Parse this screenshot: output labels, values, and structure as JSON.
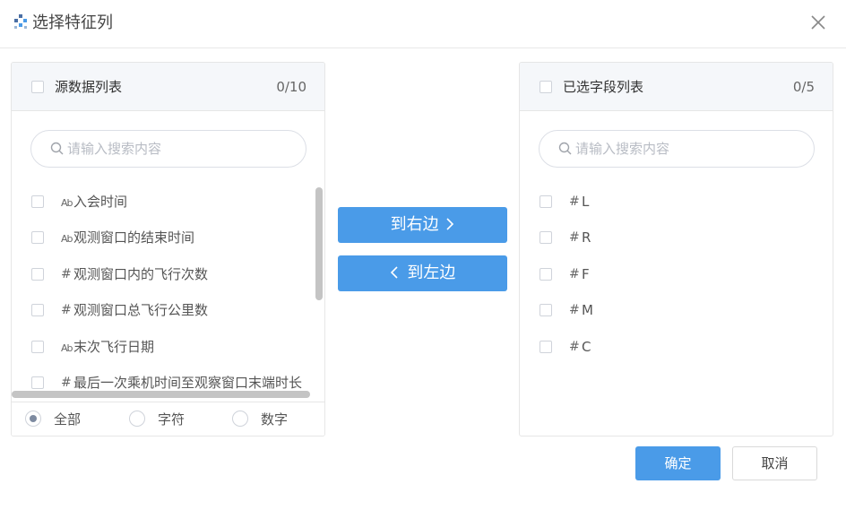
{
  "dialog": {
    "title": "选择特征列"
  },
  "source": {
    "title": "源数据列表",
    "count": "0/10",
    "search_placeholder": "请输入搜索内容",
    "items": [
      {
        "type": "Ab",
        "label": "入会时间"
      },
      {
        "type": "Ab",
        "label": "观测窗口的结束时间"
      },
      {
        "type": "#",
        "label": "观测窗口内的飞行次数"
      },
      {
        "type": "#",
        "label": "观测窗口总飞行公里数"
      },
      {
        "type": "Ab",
        "label": "末次飞行日期"
      },
      {
        "type": "#",
        "label": "最后一次乘机时间至观察窗口末端时长"
      }
    ],
    "filters": [
      {
        "label": "全部",
        "checked": true
      },
      {
        "label": "字符",
        "checked": false
      },
      {
        "label": "数字",
        "checked": false
      }
    ]
  },
  "transfer": {
    "to_right": "到右边",
    "to_left": "到左边"
  },
  "target": {
    "title": "已选字段列表",
    "count": "0/5",
    "search_placeholder": "请输入搜索内容",
    "items": [
      {
        "type": "#",
        "label": "L"
      },
      {
        "type": "#",
        "label": "R"
      },
      {
        "type": "#",
        "label": "F"
      },
      {
        "type": "#",
        "label": "M"
      },
      {
        "type": "#",
        "label": "C"
      }
    ]
  },
  "footer": {
    "ok_label": "确定",
    "cancel_label": "取消"
  },
  "colors": {
    "primary": "#4a9be8",
    "panel_header_bg": "#f5f7fa",
    "scrollbar": "#c4c4c4"
  }
}
